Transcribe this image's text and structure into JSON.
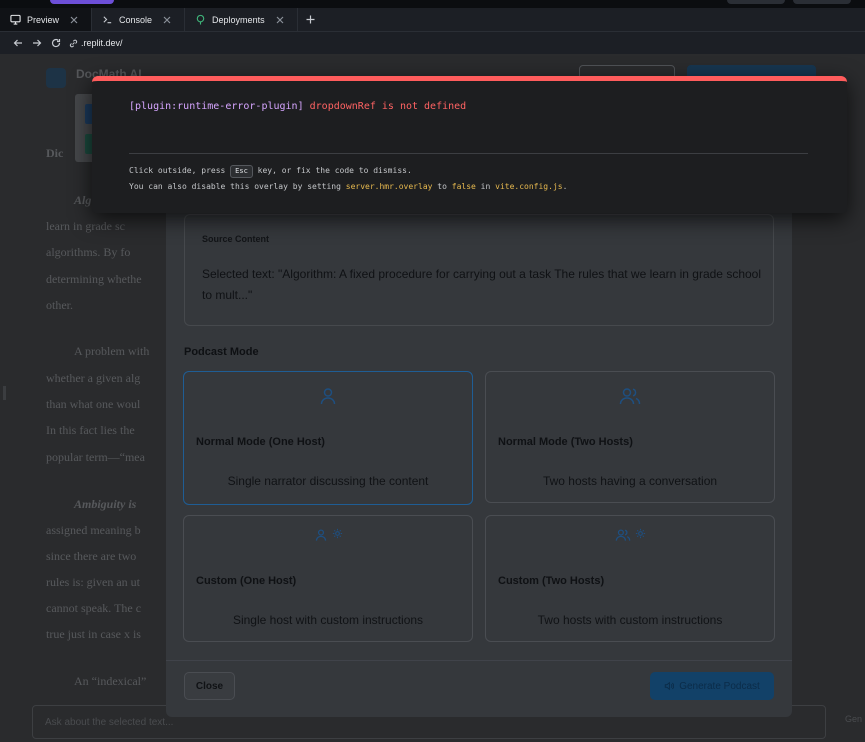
{
  "tabs": [
    {
      "label": "Preview",
      "active": true,
      "icon": "monitor-icon"
    },
    {
      "label": "Console",
      "active": false,
      "icon": "terminal-icon"
    },
    {
      "label": "Deployments",
      "active": false,
      "icon": "deploy-icon"
    }
  ],
  "url": ".replit.dev/",
  "page_behind": {
    "app_title": "DocMath AI",
    "heading": "Dic",
    "fragments": [
      "Alg",
      "learn in grade sc",
      "algorithms. By fo",
      "determining whethe",
      "other.",
      "A problem with",
      "whether a given alg",
      "than what one woul",
      "In this fact lies the",
      "popular term—“mea",
      "Ambiguity is",
      "assigned meaning b",
      "since there are two",
      "rules is: given an ut",
      "cannot speak. The c",
      "true just in case x is",
      "An “indexical”"
    ],
    "input_placeholder": "Ask about the selected text...",
    "send_label": "Gen"
  },
  "modal": {
    "source": {
      "title": "Source Content",
      "text": "Selected text: \"Algorithm: A fixed procedure for carrying out a task The rules that we learn in grade school to mult...\""
    },
    "mode_label": "Podcast Mode",
    "options": [
      {
        "title": "Normal Mode (One Host)",
        "desc": "Single narrator discussing the content",
        "selected": true
      },
      {
        "title": "Normal Mode (Two Hosts)",
        "desc": "Two hosts having a conversation",
        "selected": false
      },
      {
        "title": "Custom (One Host)",
        "desc": "Single host with custom instructions",
        "selected": false
      },
      {
        "title": "Custom (Two Hosts)",
        "desc": "Two hosts with custom instructions",
        "selected": false
      }
    ],
    "close_label": "Close",
    "generate_label": "Generate Podcast"
  },
  "error_overlay": {
    "plugin": "[plugin:runtime-error-plugin]",
    "message": "dropdownRef is not defined",
    "tip1_a": "Click outside, press",
    "tip1_key": "Esc",
    "tip1_b": "key, or fix the code to dismiss.",
    "tip2_a": "You can also disable this overlay by setting",
    "tip2_code1": "server.hmr.overlay",
    "tip2_to": "to",
    "tip2_code2": "false",
    "tip2_in": "in",
    "tip2_code3": "vite.config.js",
    "tip2_end": "."
  },
  "colors": {
    "error_bar": "#ff5c5c",
    "plugin_text": "#d6a5ff",
    "error_text": "#ff6363",
    "code_text": "#e7b94f",
    "accent_blue": "#124168"
  }
}
